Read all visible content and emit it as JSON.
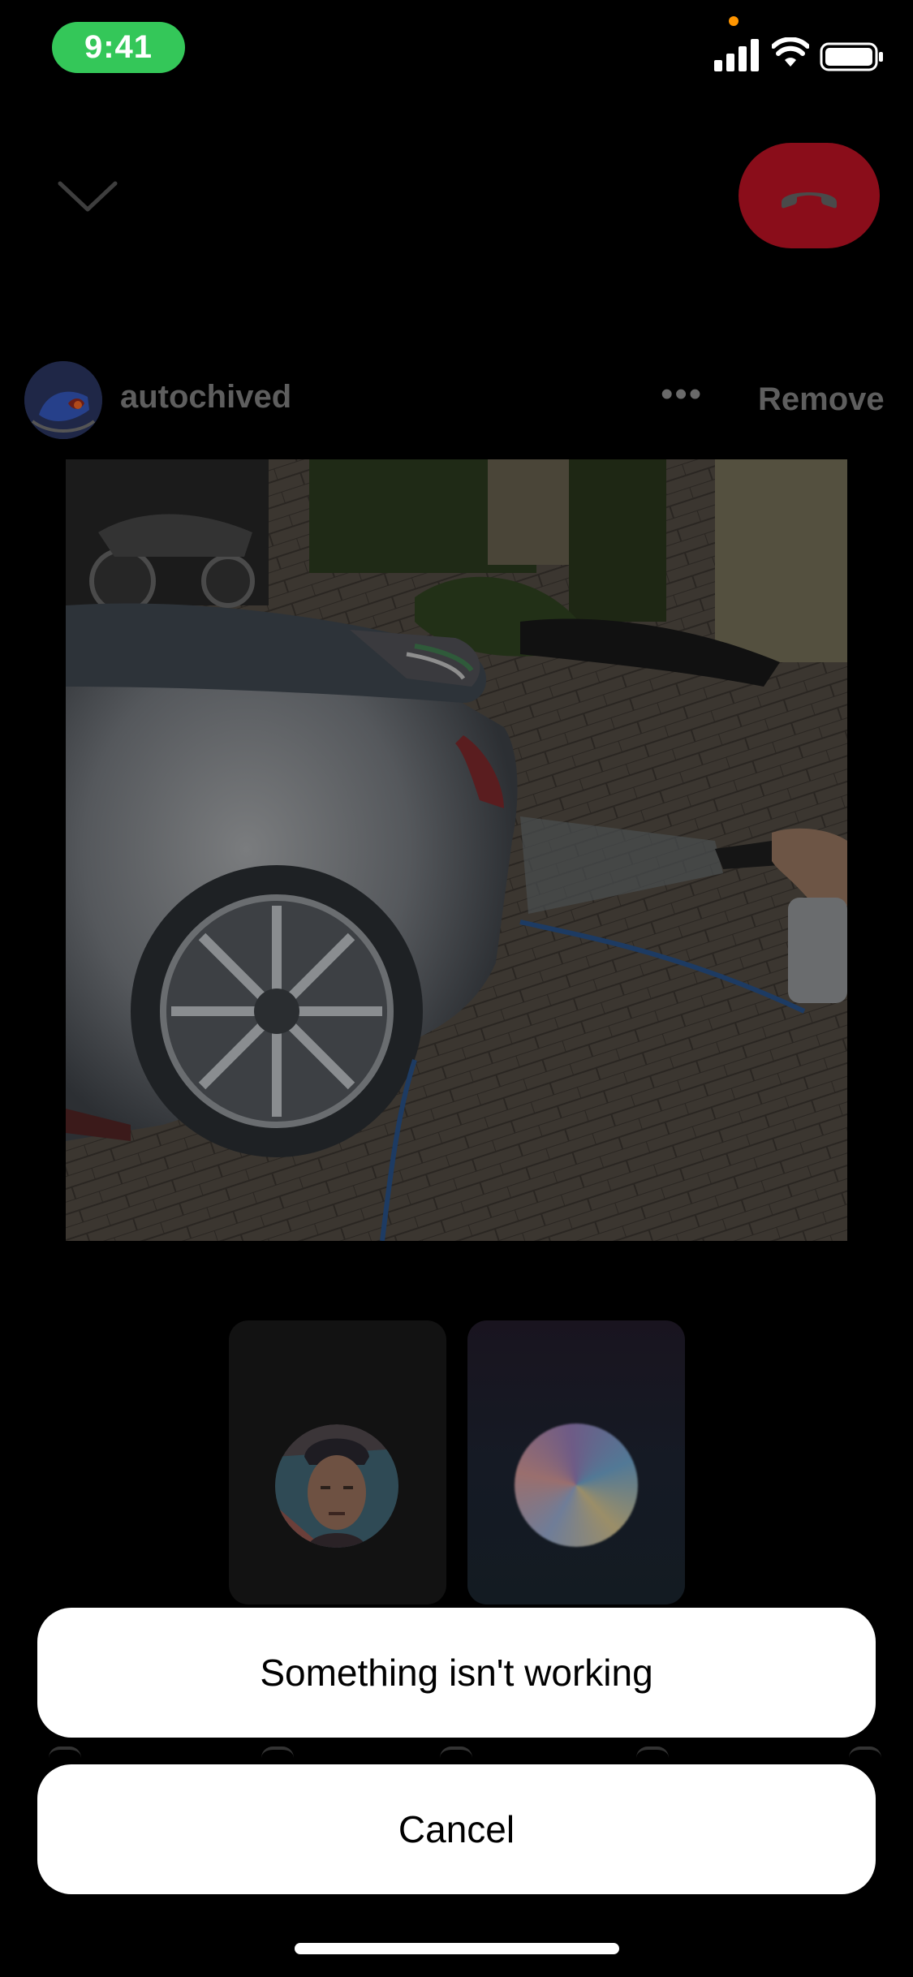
{
  "status_bar": {
    "time": "9:41"
  },
  "call": {
    "minimize_icon": "chevron-down-icon",
    "end_call_icon": "phone-hangup-icon",
    "end_call_color": "#8a0d1a"
  },
  "post": {
    "username": "autochived",
    "more_label": "•••",
    "remove_label": "Remove"
  },
  "action_sheet": {
    "primary": "Something isn't working",
    "cancel": "Cancel"
  },
  "colors": {
    "status_pill": "#34c759",
    "sheet_bg": "#ffffff"
  }
}
